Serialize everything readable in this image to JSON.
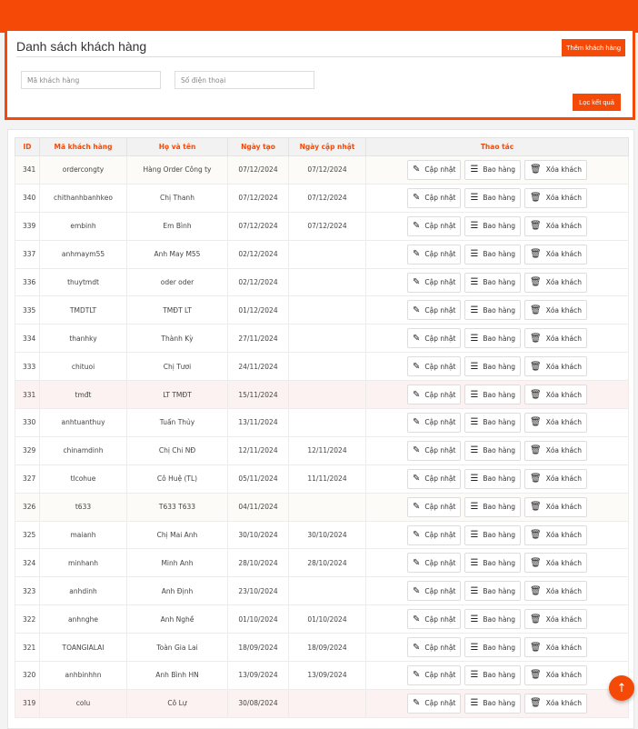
{
  "header": {
    "title": "Danh sách khách hàng",
    "add_button": "Thêm khách hàng",
    "filter_button": "Lọc kết quả",
    "customer_code_placeholder": "Mã khách hàng",
    "phone_placeholder": "Số điện thoại"
  },
  "table": {
    "columns": [
      "ID",
      "Mã khách hàng",
      "Họ và tên",
      "Ngày tạo",
      "Ngày cập nhật",
      "Thao tác"
    ],
    "actions": {
      "update": "Cập nhật",
      "orders": "Bao hàng",
      "delete": "Xóa khách"
    },
    "rows": [
      {
        "id": "341",
        "code": "ordercongty",
        "name": "Hàng Order Công ty",
        "created": "07/12/2024",
        "updated": "07/12/2024"
      },
      {
        "id": "340",
        "code": "chithanhbanhkeo",
        "name": "Chị Thanh",
        "created": "07/12/2024",
        "updated": "07/12/2024"
      },
      {
        "id": "339",
        "code": "embinh",
        "name": "Em Bình",
        "created": "07/12/2024",
        "updated": "07/12/2024"
      },
      {
        "id": "337",
        "code": "anhmaym55",
        "name": "Anh May M55",
        "created": "02/12/2024",
        "updated": ""
      },
      {
        "id": "336",
        "code": "thuytmdt",
        "name": "oder oder",
        "created": "02/12/2024",
        "updated": ""
      },
      {
        "id": "335",
        "code": "TMDTLT",
        "name": "TMĐT LT",
        "created": "01/12/2024",
        "updated": ""
      },
      {
        "id": "334",
        "code": "thanhky",
        "name": "Thành Kỳ",
        "created": "27/11/2024",
        "updated": ""
      },
      {
        "id": "333",
        "code": "chituoi",
        "name": "Chị Tươi",
        "created": "24/11/2024",
        "updated": ""
      },
      {
        "id": "331",
        "code": "tmđt",
        "name": "LT TMĐT",
        "created": "15/11/2024",
        "updated": ""
      },
      {
        "id": "330",
        "code": "anhtuanthuy",
        "name": "Tuấn Thủy",
        "created": "13/11/2024",
        "updated": ""
      },
      {
        "id": "329",
        "code": "chinamdinh",
        "name": "Chị Chi NĐ",
        "created": "12/11/2024",
        "updated": "12/11/2024"
      },
      {
        "id": "327",
        "code": "tlcohue",
        "name": "Cô Huệ (TL)",
        "created": "05/11/2024",
        "updated": "11/11/2024"
      },
      {
        "id": "326",
        "code": "t633",
        "name": "T633 T633",
        "created": "04/11/2024",
        "updated": ""
      },
      {
        "id": "325",
        "code": "maianh",
        "name": "Chị Mai Anh",
        "created": "30/10/2024",
        "updated": "30/10/2024"
      },
      {
        "id": "324",
        "code": "minhanh",
        "name": "Minh Anh",
        "created": "28/10/2024",
        "updated": "28/10/2024"
      },
      {
        "id": "323",
        "code": "anhdinh",
        "name": "Anh Định",
        "created": "23/10/2024",
        "updated": ""
      },
      {
        "id": "322",
        "code": "anhnghe",
        "name": "Anh Nghề",
        "created": "01/10/2024",
        "updated": "01/10/2024"
      },
      {
        "id": "321",
        "code": "TOANGIALAI",
        "name": "Toàn Gia Lai",
        "created": "18/09/2024",
        "updated": "18/09/2024"
      },
      {
        "id": "320",
        "code": "anhbinhhn",
        "name": "Anh Bình HN",
        "created": "13/09/2024",
        "updated": "13/09/2024"
      },
      {
        "id": "319",
        "code": "colu",
        "name": "Cô Lự",
        "created": "30/08/2024",
        "updated": ""
      }
    ]
  },
  "colors": {
    "accent": "#f54a07"
  },
  "icons": {
    "update": "pencil-icon",
    "orders": "list-icon",
    "delete": "trash-icon",
    "scroll_top": "arrow-up-icon"
  }
}
